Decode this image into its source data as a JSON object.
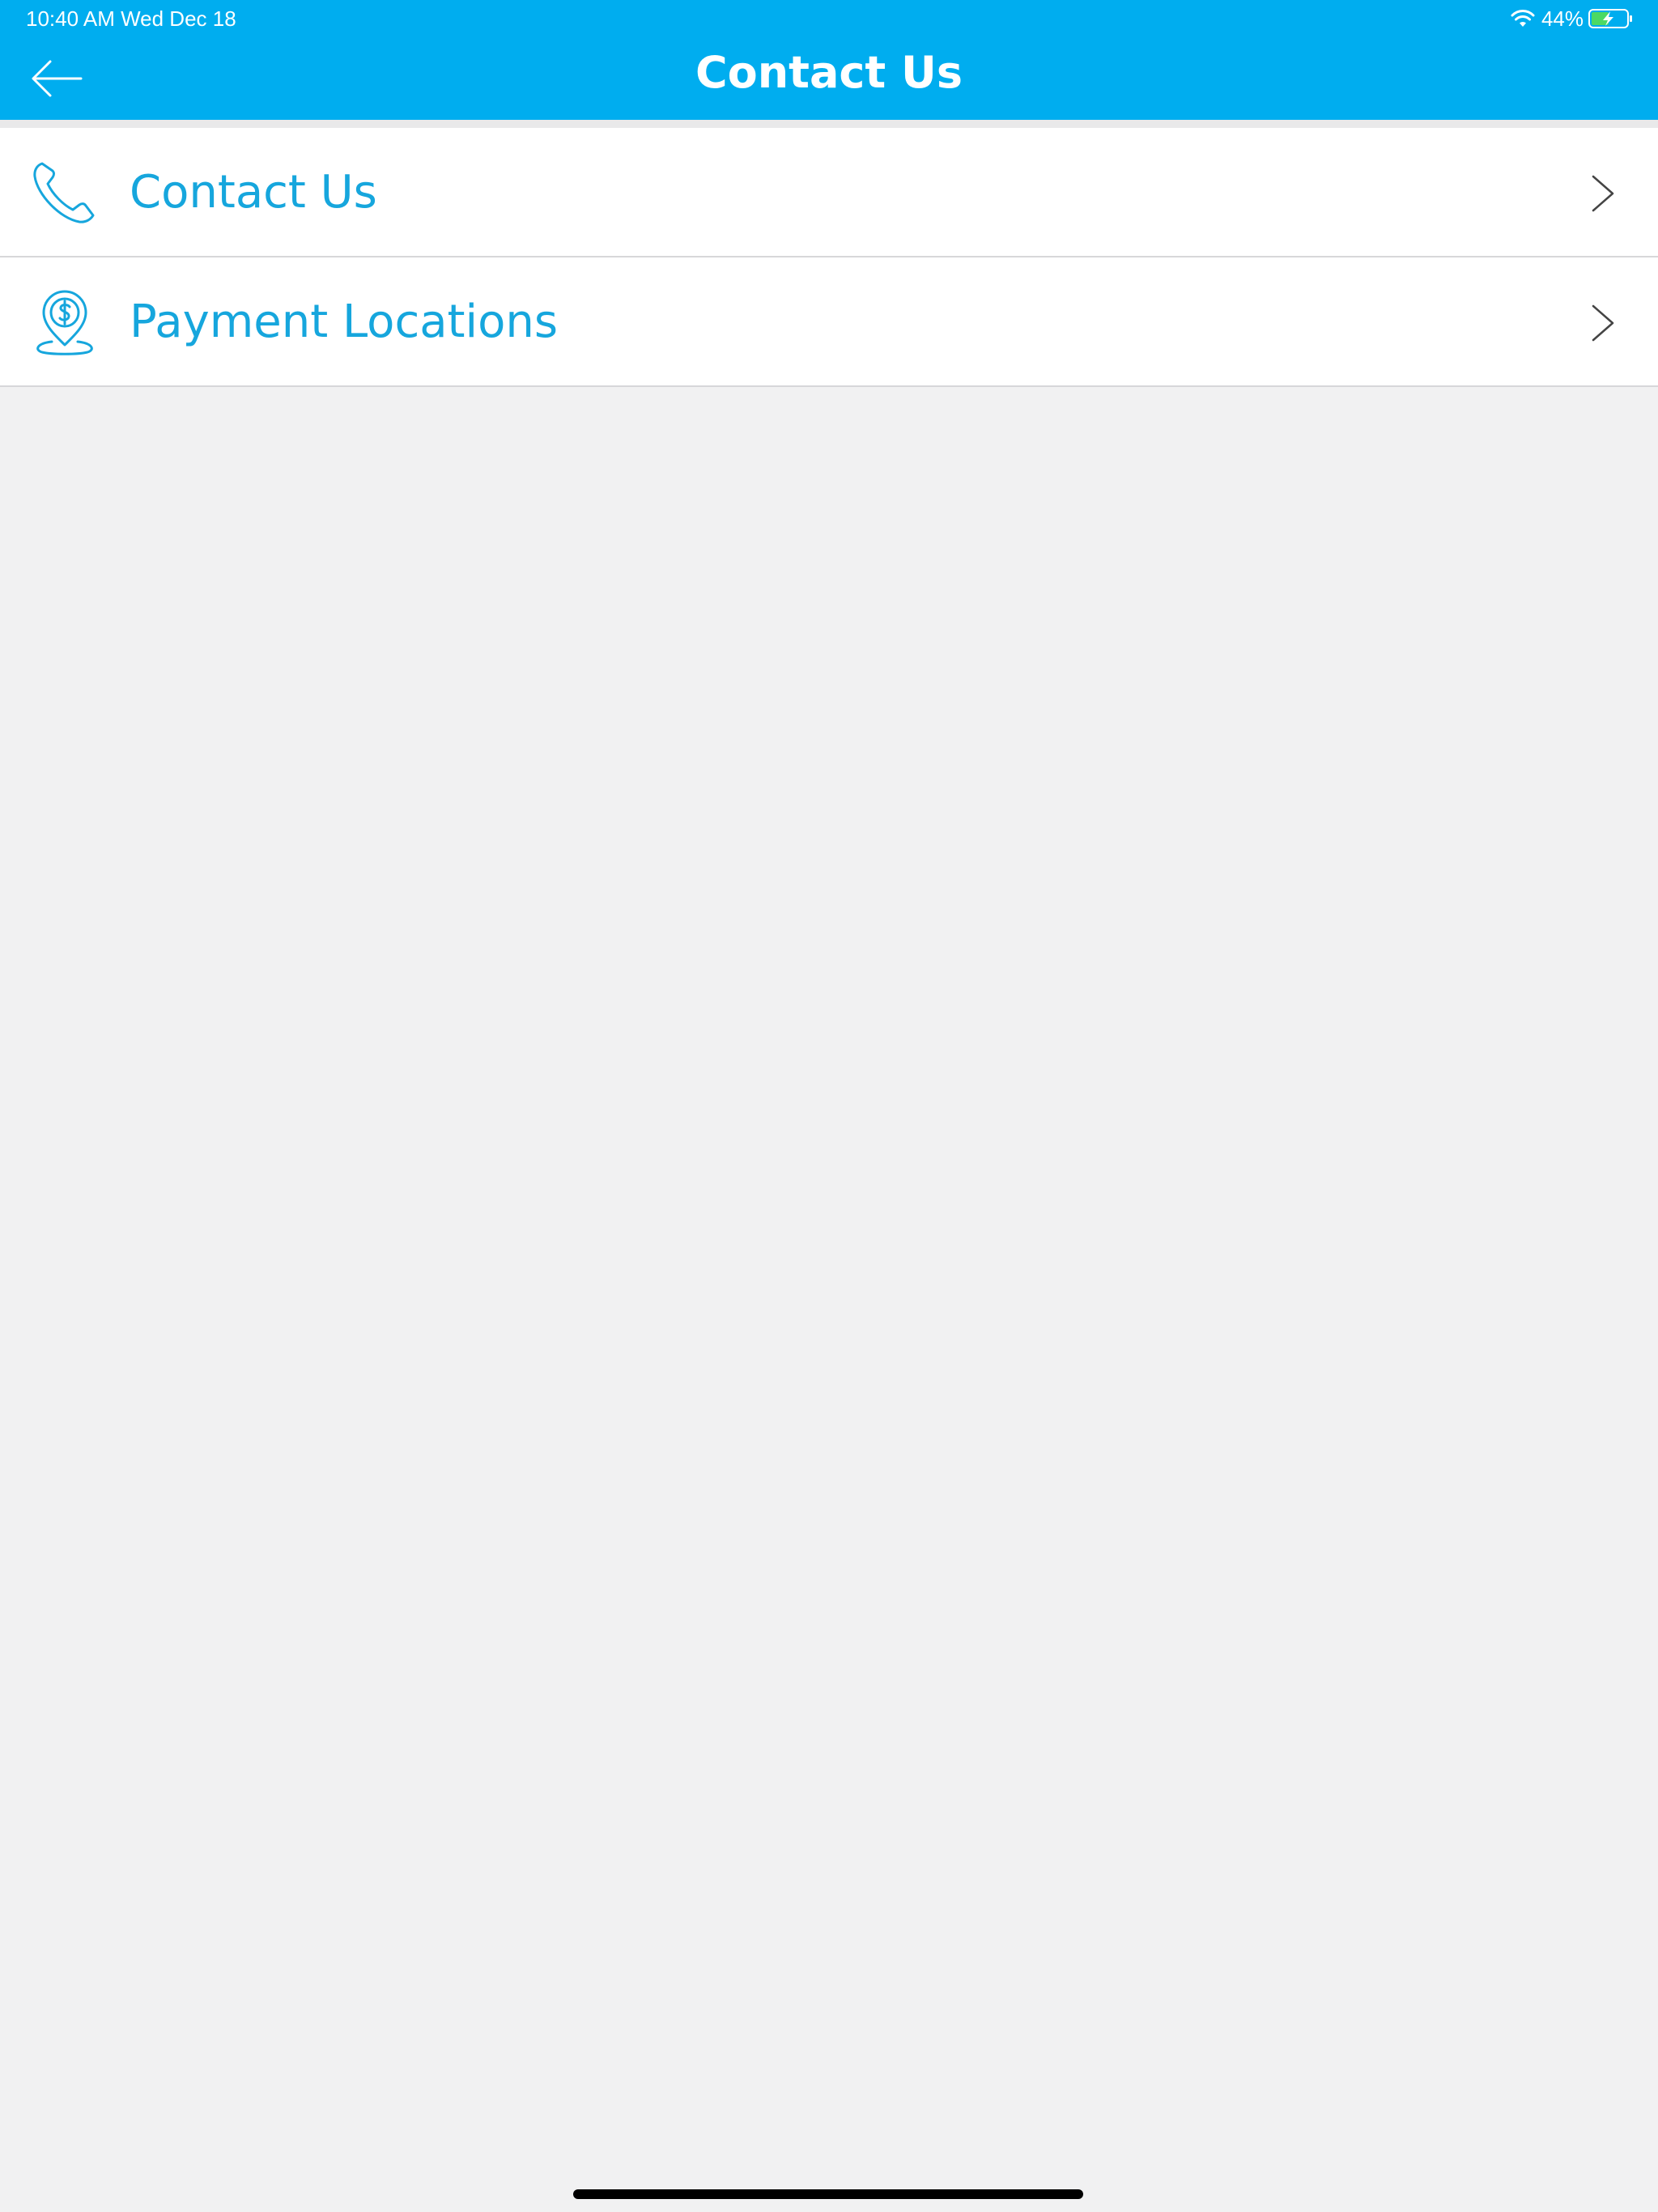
{
  "status_bar": {
    "time": "10:40 AM   Wed Dec 18",
    "battery_percent": "44%",
    "wifi_icon": "wifi-icon",
    "battery_icon": "battery-charging-icon"
  },
  "header": {
    "title": "Contact Us",
    "back_icon": "arrow-left-icon",
    "background_color": "#00adef"
  },
  "menu": {
    "items": [
      {
        "label": "Contact Us",
        "icon": "phone-icon"
      },
      {
        "label": "Payment Locations",
        "icon": "location-dollar-icon"
      }
    ],
    "accent_color": "#16a6dd",
    "chevron_icon": "chevron-right-icon"
  }
}
